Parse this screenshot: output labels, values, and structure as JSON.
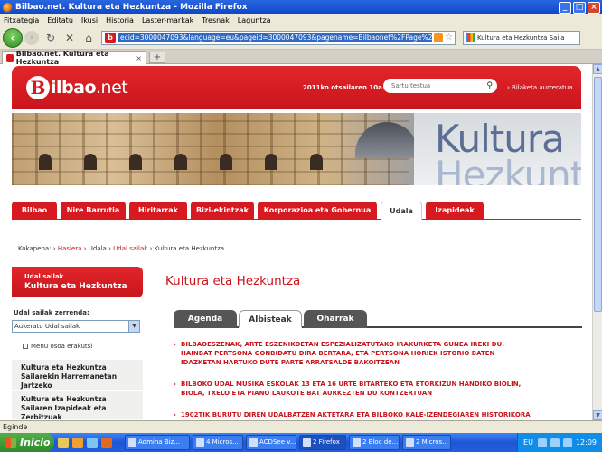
{
  "window": {
    "title": "Bilbao.net. Kultura eta Hezkuntza - Mozilla Firefox"
  },
  "menu": [
    "Fitxategia",
    "Editatu",
    "Ikusi",
    "Historia",
    "Laster-markak",
    "Tresnak",
    "Laguntza"
  ],
  "toolbar": {
    "url": "ecid=3000047093&language=eu&pageid=3000047093&pagename=Bilbaonet%2FPage%2FBIO_homeArea",
    "search_text": "Kultura eta Hezkuntza Saila"
  },
  "tabs": {
    "active_label": "Bilbao.net. Kultura eta Hezkuntza",
    "new_tab": "+"
  },
  "site": {
    "logo_b": "B",
    "logo_text": "ilbao",
    "logo_dot": ".net",
    "date": "2011ko otsailaren 10a",
    "search_placeholder": "Sartu testua",
    "home_link": "› Bilaketa aurreratua",
    "banner_word1": "Kultura",
    "banner_word2": "Hezkuntza"
  },
  "nav": [
    {
      "label": "Bilbao"
    },
    {
      "label": "Nire Barrutia"
    },
    {
      "label": "Hiritarrak"
    },
    {
      "label": "Bizi-ekintzak"
    },
    {
      "label": "Korporazioa eta Gobernua"
    },
    {
      "label": "Udala"
    },
    {
      "label": "Izapideak"
    }
  ],
  "breadcrumb": {
    "prefix": "Kokapena: ›",
    "items": [
      "Hasiera",
      "Udala",
      "Udal sailak",
      "Kultura eta Hezkuntza"
    ],
    "sep": "›"
  },
  "left": {
    "box_small": "Udal sailak",
    "box_big": "Kultura eta Hezkuntza",
    "select_label": "Udal sailak zerrenda:",
    "select_value": "Aukeratu Udal sailak",
    "menu_link": "Menu osoa erakutsi",
    "items": [
      "Kultura eta Hezkuntza Sailarekin Harremanetan Jartzeko",
      "Kultura eta Hezkuntza Sailaren Izapideak eta Zerbitzuak"
    ]
  },
  "main": {
    "title": "Kultura eta Hezkuntza",
    "tabs": [
      "Agenda",
      "Albisteak",
      "Oharrak"
    ],
    "news": [
      "BILBAOESZENAK, ARTE ESZENIKOETAN ESPEZIALIZATUTAKO IRAKURKETA GUNEA IREKI DU. HAINBAT PERTSONA GONBIDATU DIRA BERTARA, ETA PERTSONA HORIEK ISTORIO BATEN IDAZKETAN HARTUKO DUTE PARTE ARRATSALDE BAKOITZEAN",
      "BILBOKO UDAL MUSIKA ESKOLAK 13 ETA 16 URTE BITARTEKO ETA ETORKIZUN HANDIKO BIOLIN, BIOLA, TXELO ETA PIANO LAUKOTE BAT AURKEZTEN DU KONTZERTUAN",
      "1902TIK BURUTU DIREN UDALBATZEN AKTETARA ETA BILBOKO KALE-IZENDEGIAREN HISTORIKORA"
    ],
    "bullet": "›"
  },
  "status": {
    "text": "Egində"
  },
  "taskbar": {
    "start": "Inicio",
    "buttons": [
      "Admina Biz...",
      "4 Micros...",
      "ACDSee v...",
      "2 Firefox",
      "2 Bloc de...",
      "2 Micros..."
    ],
    "lang": "EU",
    "clock": "12:09"
  }
}
